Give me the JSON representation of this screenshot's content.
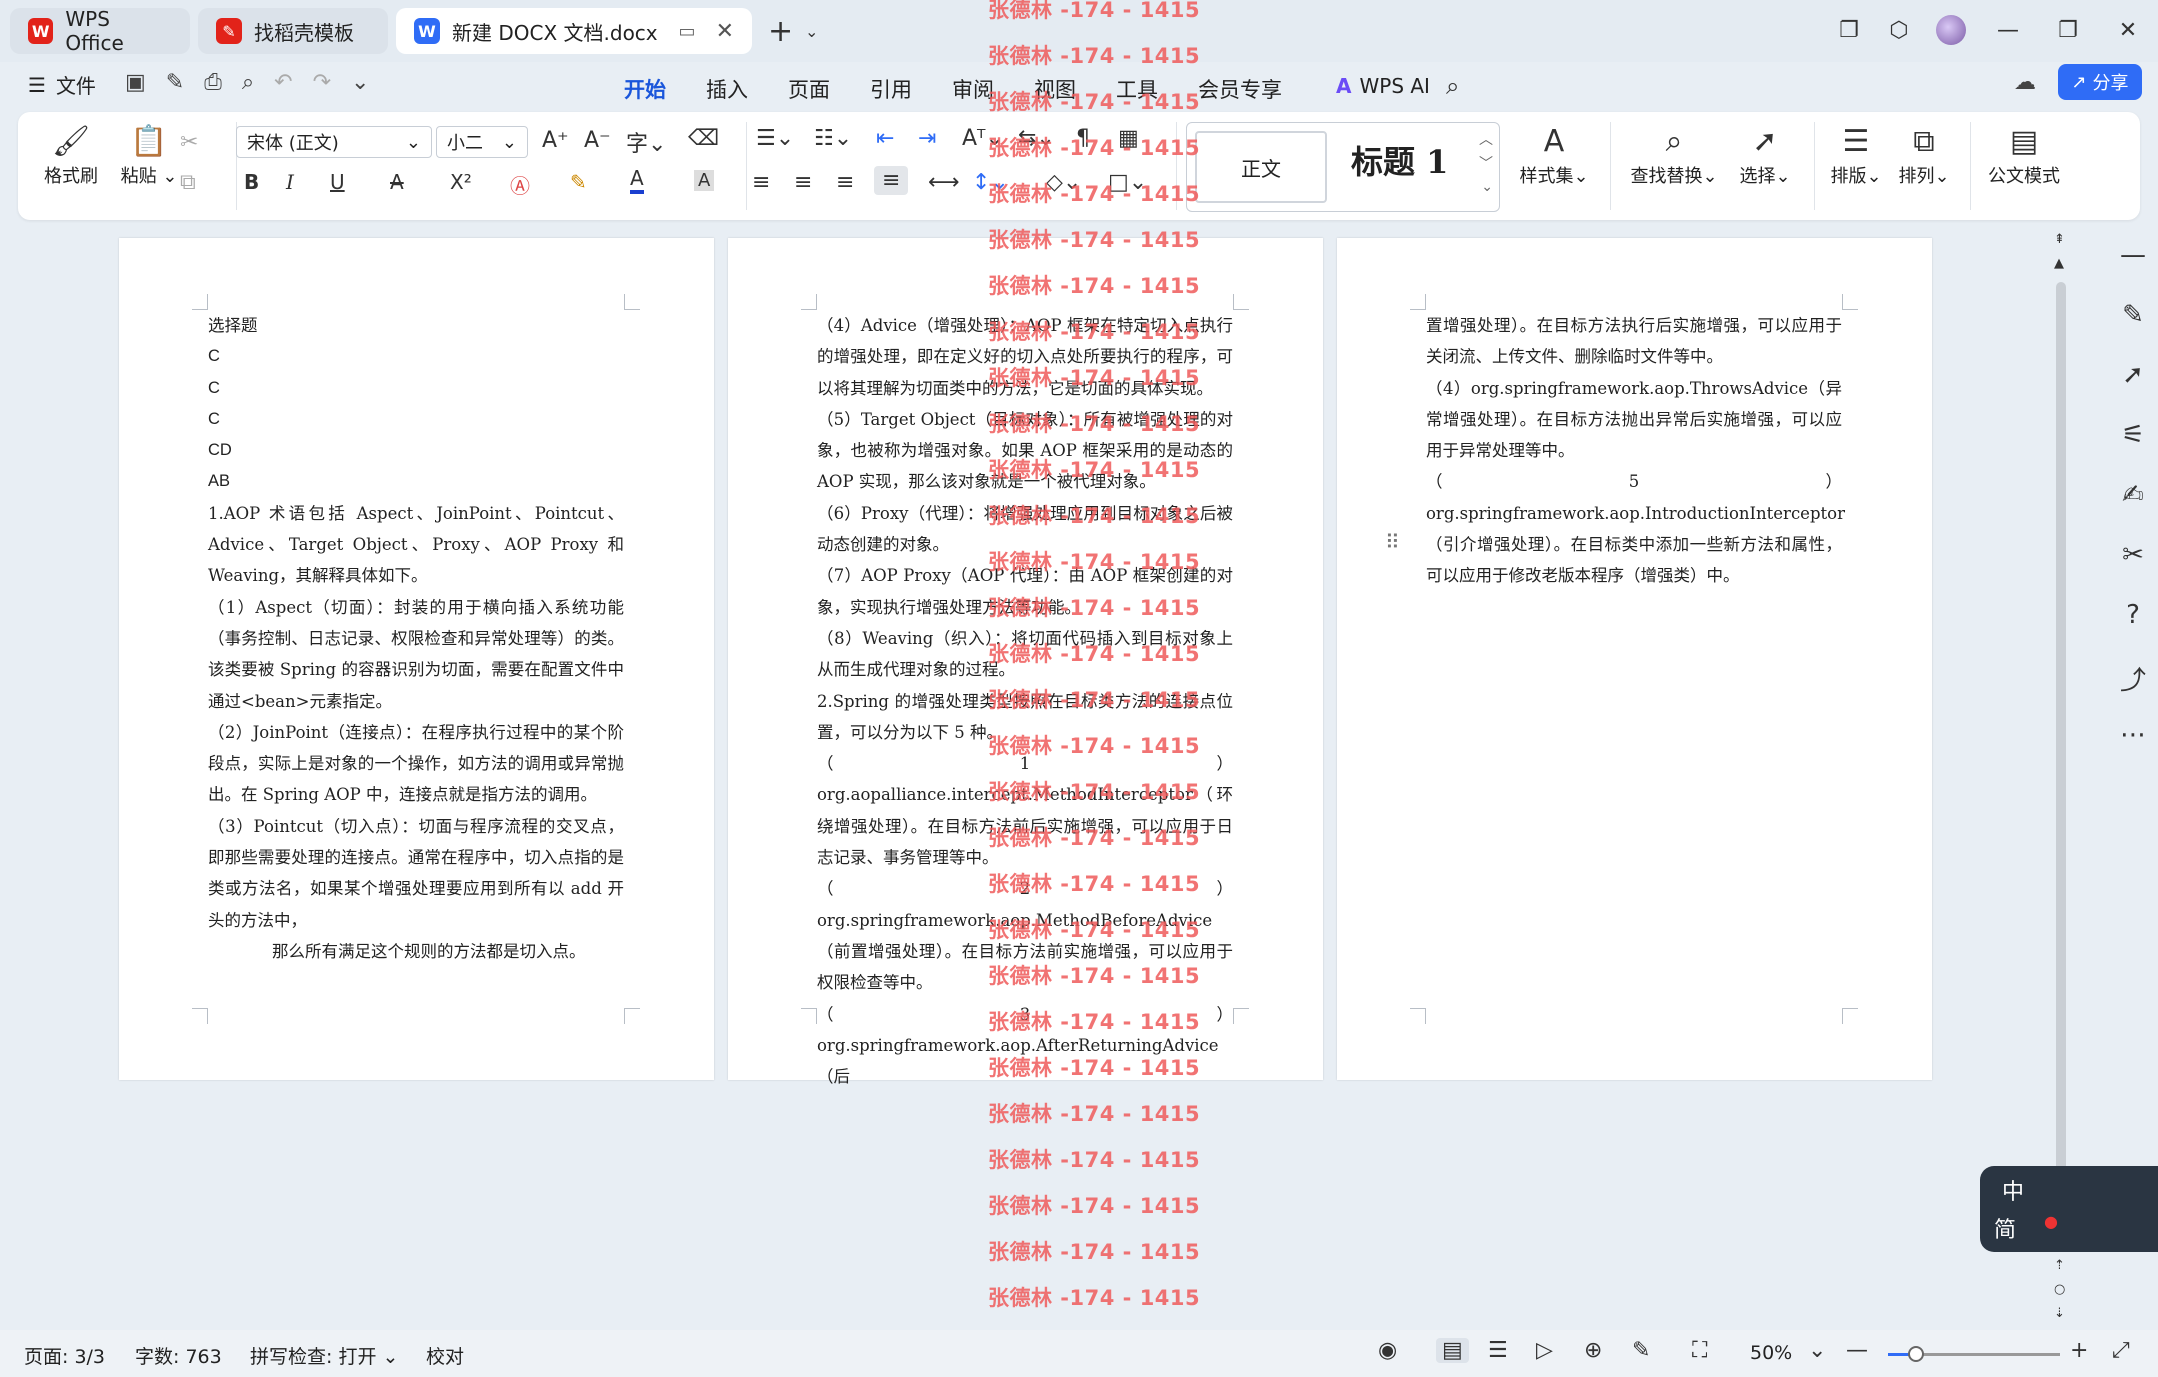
{
  "tabs": [
    {
      "label": "WPS Office",
      "icon": "wps-logo-icon"
    },
    {
      "label": "找稻壳模板",
      "icon": "docer-icon"
    },
    {
      "label": "新建 DOCX 文档.docx",
      "icon": "word-doc-icon"
    }
  ],
  "menu": {
    "file": "文件",
    "tabs": [
      "开始",
      "插入",
      "页面",
      "引用",
      "审阅",
      "视图",
      "工具",
      "会员专享"
    ],
    "active_tab": "开始",
    "wps_ai": "WPS AI",
    "share": "分享"
  },
  "ribbon": {
    "format_painter": "格式刷",
    "paste": "粘贴",
    "font_name": "宋体 (正文)",
    "font_size": "小二",
    "style_normal": "正文",
    "style_heading": "标题 1",
    "style_set": "样式集",
    "find_replace": "查找替换",
    "select": "选择",
    "layout": "排版",
    "arrange": "排列",
    "doc_mode": "公文模式",
    "bold": "B",
    "italic": "I",
    "underline": "U",
    "strike": "A",
    "superscript": "X²",
    "font_color_a": "A",
    "char_shade": "A",
    "grow": "A⁺",
    "shrink": "A⁻"
  },
  "pages": {
    "page1": [
      "选择题",
      "C",
      "C",
      "C",
      "CD",
      "AB",
      "1.AOP 术语包括 Aspect、JoinPoint、Pointcut、Advice、Target Object、Proxy、AOP Proxy 和 Weaving，其解释具体如下。",
      "（1）Aspect（切面）：封装的用于横向插入系统功能（事务控制、日志记录、权限检查和异常处理等）的类。该类要被 Spring 的容器识别为切面，需要在配置文件中通过<bean>元素指定。",
      "（2）JoinPoint（连接点）：在程序执行过程中的某个阶段点，实际上是对象的一个操作，如方法的调用或异常抛出。在 Spring AOP 中，连接点就是指方法的调用。",
      "（3）Pointcut（切入点）：切面与程序流程的交叉点，即那些需要处理的连接点。通常在程序中，切入点指的是类或方法名，如果某个增强处理要应用到所有以 add 开头的方法中，",
      "那么所有满足这个规则的方法都是切入点。"
    ],
    "page2": [
      "（4）Advice（增强处理）：AOP 框架在特定切入点执行的增强处理，即在定义好的切入点处所要执行的程序，可以将其理解为切面类中的方法，它是切面的具体实现。",
      "（5）Target Object（目标对象）：所有被增强处理的对象，也被称为增强对象。如果 AOP 框架采用的是动态的 AOP 实现，那么该对象就是一个被代理对象。",
      "（6）Proxy（代理）：将增强处理应用到目标对象之后被动态创建的对象。",
      "（7）AOP Proxy（AOP 代理）：由 AOP 框架创建的对象，实现执行增强处理方法等功能。",
      "（8）Weaving（织入）：将切面代码插入到目标对象上从而生成代理对象的过程。",
      "2.Spring 的增强处理类型按照在目标类方法的连接点位置，可以分为以下 5 种。",
      "（1）org.aopalliance.intercept.MethodInterceptor（环绕增强处理）。在目标方法前后实施增强，可以应用于日志记录、事务管理等中。",
      "（2）org.springframework.aop.MethodBeforeAdvice（前置增强处理）。在目标方法前实施增强，可以应用于权限检查等中。",
      "（3）org.springframework.aop.AfterReturningAdvice（后"
    ],
    "page3": [
      "置增强处理）。在目标方法执行后实施增强，可以应用于关闭流、上传文件、删除临时文件等中。",
      "（4）org.springframework.aop.ThrowsAdvice（异常增强处理）。在目标方法抛出异常后实施增强，可以应用于异常处理等中。",
      "（5）org.springframework.aop.IntroductionInterceptor（引介增强处理）。在目标类中添加一些新方法和属性，可以应用于修改老版本程序（增强类）中。"
    ]
  },
  "watermark": "张德林 -174 - 1415",
  "ime": {
    "line1": "中",
    "line2": "简"
  },
  "status": {
    "page": "页面: 3/3",
    "words": "字数: 763",
    "spell": "拼写检查: 打开",
    "proof": "校对",
    "zoom": "50%",
    "zoom_level": 0.16
  },
  "colors": {
    "accent": "#1a56db",
    "share_bg": "#2f6cf6",
    "watermark": "#ee5a5a"
  }
}
